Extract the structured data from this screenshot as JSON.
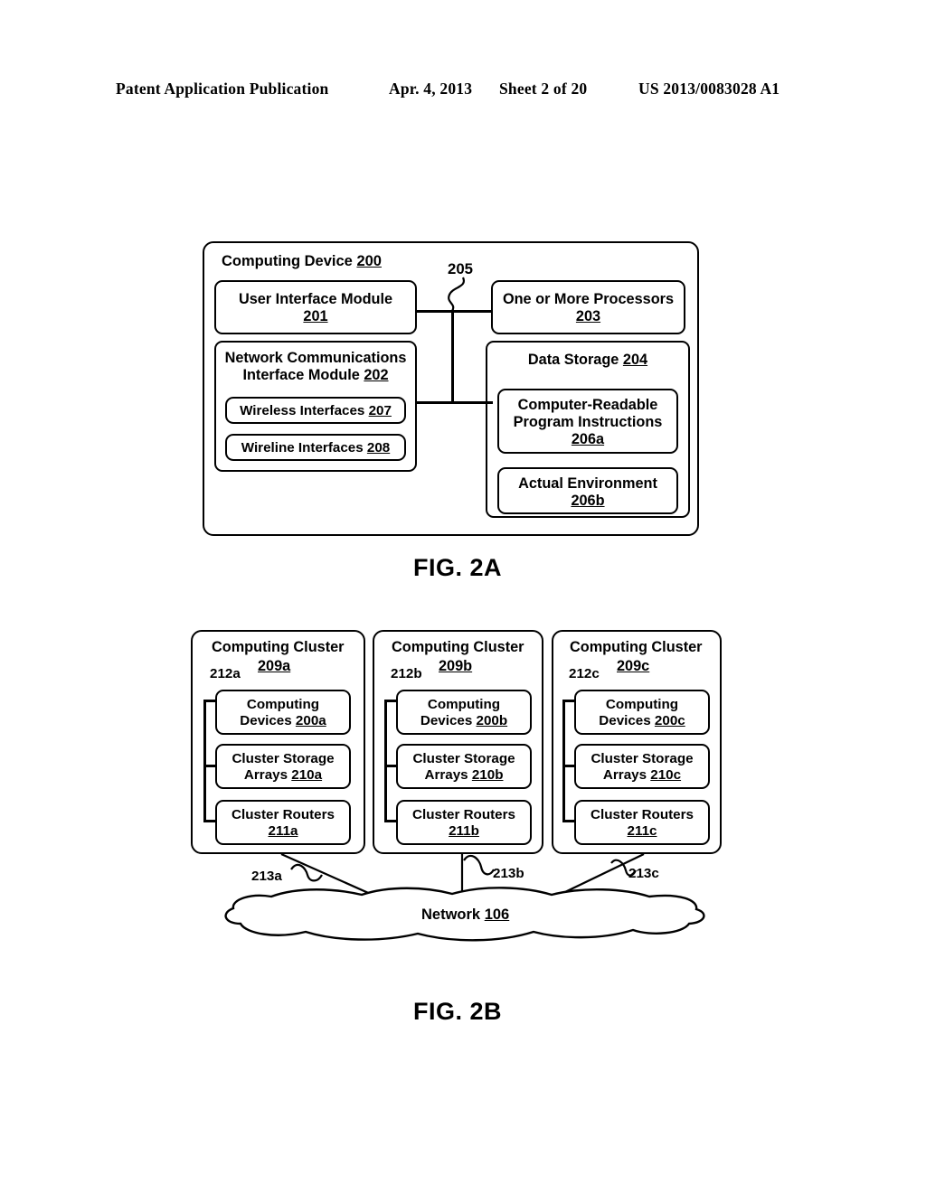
{
  "header": {
    "publication": "Patent Application Publication",
    "date": "Apr. 4, 2013",
    "sheet": "Sheet 2 of 20",
    "number": "US 2013/0083028 A1"
  },
  "fig2a": {
    "caption": "FIG. 2A",
    "outer": {
      "title": "Computing Device ",
      "ref": "200"
    },
    "bus_label": "205",
    "blocks": [
      {
        "line1": "User Interface Module",
        "ref": "201"
      },
      {
        "line1": "Network Communications",
        "line2": "Interface Module ",
        "ref": "202"
      },
      {
        "line1": "Wireless Interfaces ",
        "ref": "207"
      },
      {
        "line1": "Wireline Interfaces ",
        "ref": "208"
      },
      {
        "line1": "One or More Processors",
        "ref": "203"
      },
      {
        "line1": "Data Storage ",
        "ref": "204"
      },
      {
        "line1": "Computer-Readable",
        "line2": "Program Instructions",
        "ref": "206a"
      },
      {
        "line1": "Actual Environment",
        "ref": "206b"
      }
    ]
  },
  "fig2b": {
    "caption": "FIG. 2B",
    "clusters": [
      {
        "title": "Computing Cluster",
        "ref": "209a",
        "bus_label": "212a",
        "link_label": "213a",
        "items": [
          {
            "line1": "Computing",
            "line2": "Devices ",
            "ref": "200a"
          },
          {
            "line1": "Cluster Storage",
            "line2": "Arrays ",
            "ref": "210a"
          },
          {
            "line1": "Cluster Routers",
            "ref": "211a"
          }
        ]
      },
      {
        "title": "Computing Cluster",
        "ref": "209b",
        "bus_label": "212b",
        "link_label": "213b",
        "items": [
          {
            "line1": "Computing",
            "line2": "Devices ",
            "ref": "200b"
          },
          {
            "line1": "Cluster Storage",
            "line2": "Arrays ",
            "ref": "210b"
          },
          {
            "line1": "Cluster Routers",
            "ref": "211b"
          }
        ]
      },
      {
        "title": "Computing Cluster",
        "ref": "209c",
        "bus_label": "212c",
        "link_label": "213c",
        "items": [
          {
            "line1": "Computing",
            "line2": "Devices ",
            "ref": "200c"
          },
          {
            "line1": "Cluster Storage",
            "line2": "Arrays ",
            "ref": "210c"
          },
          {
            "line1": "Cluster Routers",
            "ref": "211c"
          }
        ]
      }
    ],
    "network": {
      "label": "Network ",
      "ref": "106"
    }
  }
}
